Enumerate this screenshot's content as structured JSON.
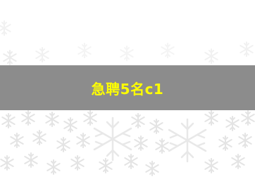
{
  "banner": {
    "text": "急聘5名c1",
    "background_color": "#8c8c8c",
    "text_color": "#ffff00"
  },
  "background": {
    "pattern_icon": "snowflake-icon",
    "pattern_color": "#e6e6e6"
  }
}
